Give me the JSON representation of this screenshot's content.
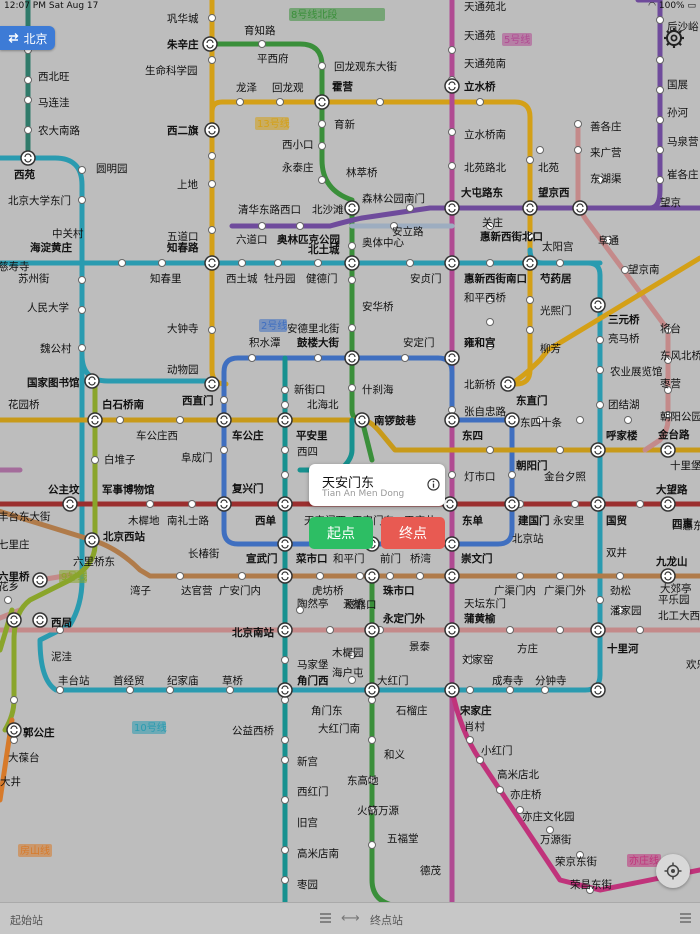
{
  "status_bar": {
    "time_date": "12:07 PM   Sat Aug 17",
    "battery": "100%"
  },
  "city": {
    "label": "北京"
  },
  "lines": [
    {
      "name": "8号线北段",
      "color": "#3a8f3a"
    },
    {
      "name": "13号线",
      "color": "#d4a017"
    },
    {
      "name": "5号线",
      "color": "#b04a92"
    },
    {
      "name": "2号线",
      "color": "#3f6fc0"
    },
    {
      "name": "9号线",
      "color": "#8aa52b"
    },
    {
      "name": "10号线",
      "color": "#2a9bb0"
    },
    {
      "name": "房山线",
      "color": "#d77a2a"
    },
    {
      "name": "亦庄线",
      "color": "#c0337b"
    }
  ],
  "stations": [
    "巩华城",
    "朱辛庄",
    "育知路",
    "平西府",
    "生命科学园",
    "回龙观东大街",
    "霍营",
    "龙泽",
    "回龙观",
    "西二旗",
    "育新",
    "西小口",
    "永泰庄",
    "上地",
    "林萃桥",
    "森林公园南门",
    "清华东路西口",
    "北沙滩",
    "奥林匹克公园",
    "奥体中心",
    "安立路",
    "关庄",
    "五道口",
    "知春路",
    "六道口",
    "北土城",
    "安贞门",
    "惠新西街南口",
    "芍药居",
    "西土城",
    "牡丹园",
    "健德门",
    "苏州街",
    "知春里",
    "人民大学",
    "安华桥",
    "和平西桥",
    "光熙门",
    "魏公村",
    "大钟寺",
    "安德里北街",
    "积水潭",
    "鼓楼大街",
    "安定门",
    "雍和宫",
    "柳芳",
    "动物园",
    "国家图书馆",
    "西直门",
    "新街口",
    "什刹海",
    "北新桥",
    "东直门",
    "花园桥",
    "白石桥南",
    "北海北",
    "南锣鼓巷",
    "张自忠路",
    "东四十条",
    "车公庄西",
    "车公庄",
    "平安里",
    "东四",
    "朝阳门",
    "白堆子",
    "阜成门",
    "西四",
    "灯市口",
    "金台夕照",
    "公主坟",
    "军事博物馆",
    "复兴门",
    "天安门西",
    "天安门东",
    "王府井",
    "东单",
    "建国门",
    "永安里",
    "国贸",
    "大望路",
    "木樨地",
    "南礼士路",
    "西单",
    "北京西站",
    "北京站",
    "六里桥东",
    "长椿街",
    "宣武门",
    "菜市口",
    "和平门",
    "前门",
    "桥湾",
    "崇文门",
    "九龙山",
    "湾子",
    "达官营",
    "广安门内",
    "虎坊桥",
    "珠市口",
    "磁器口",
    "广渠门内",
    "广渠门外",
    "双井",
    "劲松",
    "潘家园",
    "西局",
    "陶然亭",
    "天桥",
    "永定门外",
    "天坛东门",
    "蒲黄榆",
    "北京南站",
    "景泰",
    "刘家窑",
    "十里河",
    "泥洼",
    "丰台站",
    "首经贸",
    "纪家庙",
    "草桥",
    "马家堡",
    "木樨园",
    "角门西",
    "角门东",
    "海户屯",
    "大红门",
    "方庄",
    "成寿寺",
    "分钟寺",
    "石榴庄",
    "宋家庄",
    "肖村",
    "郭公庄",
    "大葆台",
    "公益西桥",
    "大红门南",
    "新宫",
    "和义",
    "西红门",
    "东高地",
    "小红门",
    "旧宫",
    "高米店北",
    "火箭万源",
    "亦庄桥",
    "高米店南",
    "五福堂",
    "亦庄文化园",
    "万源街",
    "枣园",
    "德茂",
    "荣京东街",
    "荣昌东街",
    "天通苑北",
    "天通苑",
    "天通苑南",
    "立水桥",
    "立水桥南",
    "北苑路北",
    "北苑",
    "大屯路东",
    "望京西",
    "善各庄",
    "来广营",
    "东湖渠",
    "望京",
    "望京南",
    "将台",
    "东风北桥",
    "枣营",
    "朝阳公园",
    "金台路",
    "十里堡",
    "四惠",
    "团结湖",
    "呼家楼",
    "农业展览馆",
    "亮马桥",
    "三元桥",
    "阜通",
    "孙河",
    "马泉营",
    "崔各庄",
    "国展",
    "后沙峪",
    "西苑",
    "圆明园",
    "北京大学东门",
    "中关村",
    "海淀黄庄",
    "西北旺",
    "马连洼",
    "农大南路",
    "六里桥",
    "七里庄",
    "丰台东大街",
    "花乡",
    "大井",
    "慈寿寺",
    "太阳宫",
    "惠新西街北口",
    "北工大西门",
    "平乐园",
    "大郊亭",
    "欢乐谷",
    "四惠东"
  ],
  "popup": {
    "station_cn": "天安门东",
    "station_pinyin": "Tian An Men Dong",
    "start_label": "起点",
    "end_label": "终点"
  },
  "bottom_bar": {
    "start_placeholder": "起始站",
    "swap": "⟷",
    "end_placeholder": "终点站"
  },
  "icons": {
    "city": "swap-icon",
    "settings": "gear-icon",
    "info": "info-icon",
    "locate": "locate-icon",
    "menu": "menu-icon"
  }
}
